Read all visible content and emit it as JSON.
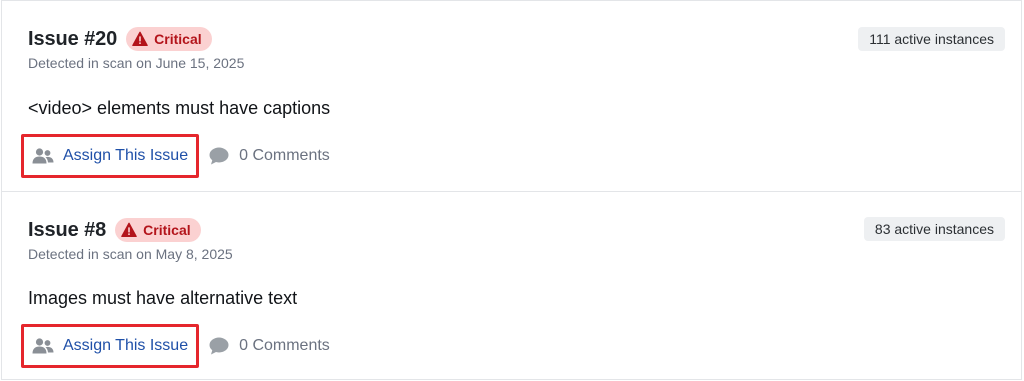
{
  "issues": [
    {
      "title": "Issue #20",
      "severity": "Critical",
      "detected": "Detected in scan on June 15, 2025",
      "instances": "111 active instances",
      "description": "<video> elements must have captions",
      "assign_label": "Assign This Issue",
      "comments_label": "0 Comments"
    },
    {
      "title": "Issue #8",
      "severity": "Critical",
      "detected": "Detected in scan on May 8, 2025",
      "instances": "83 active instances",
      "description": "Images must have alternative text",
      "assign_label": "Assign This Issue",
      "comments_label": "0 Comments"
    }
  ],
  "colors": {
    "critical_bg": "#fbd1d1",
    "critical_text": "#b3141b",
    "highlight_border": "#e5262c",
    "link": "#1f50a8"
  },
  "icons": {
    "severity": "warning-triangle-icon",
    "assign": "users-icon",
    "comments": "comment-bubble-icon"
  }
}
